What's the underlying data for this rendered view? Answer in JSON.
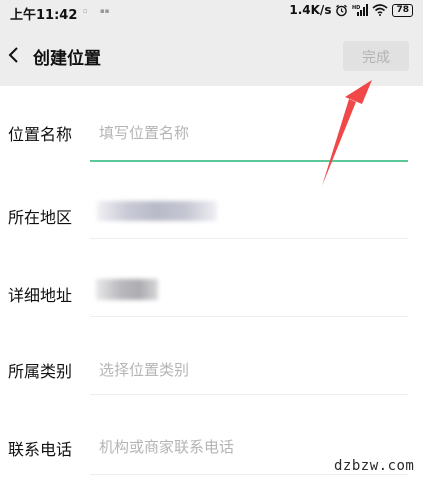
{
  "status_bar": {
    "time": "上午11:42",
    "network_speed": "1.4K/s",
    "battery": "78"
  },
  "header": {
    "back_icon": "chevron-left-icon",
    "title": "创建位置",
    "done_label": "完成"
  },
  "form": {
    "name": {
      "label": "位置名称",
      "placeholder": "填写位置名称"
    },
    "region": {
      "label": "所在地区"
    },
    "address": {
      "label": "详细地址"
    },
    "category": {
      "label": "所属类别",
      "placeholder": "选择位置类别"
    },
    "phone": {
      "label": "联系电话",
      "placeholder": "机构或商家联系电话"
    }
  },
  "colors": {
    "accent": "#5cc89a",
    "annotation_arrow": "#f04848"
  },
  "watermark": "dzbzw.com"
}
